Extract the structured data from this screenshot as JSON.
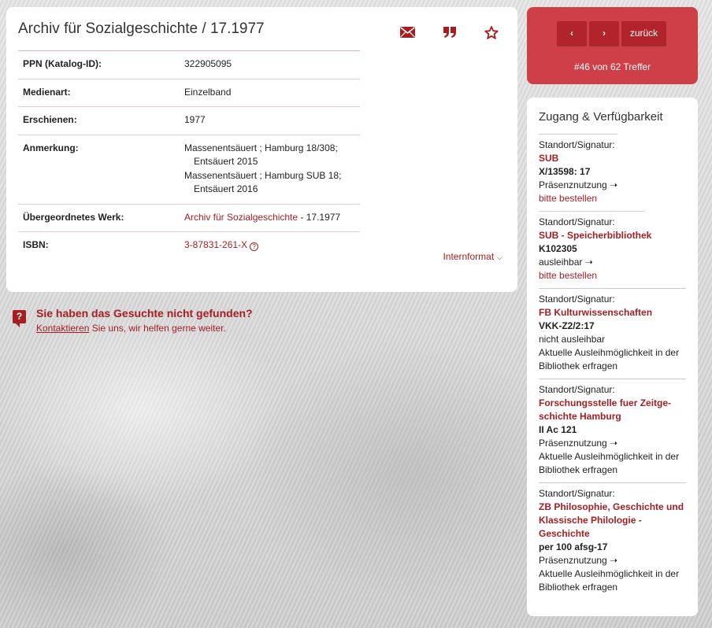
{
  "record": {
    "title": "Archiv für Sozialgeschichte / 17.1977",
    "actions": [
      {
        "icon": "mail-icon"
      },
      {
        "icon": "quote-icon"
      },
      {
        "icon": "star-icon"
      }
    ],
    "fields": [
      {
        "key": "PPN (Katalog-ID):",
        "value": "322905095"
      },
      {
        "key": "Medienart:",
        "value": "Einzelband"
      },
      {
        "key": "Erschienen:",
        "value": "1977"
      },
      {
        "key": "Anmerkung:",
        "lines": [
          "Massenentsäuert ; Hamburg 18/308;",
          "Entsäuert 2015",
          "Massenentsäuert ; Hamburg SUB 18;",
          "Entsäuert 2016"
        ]
      },
      {
        "key": "Übergeordnetes Werk:",
        "link": "Archiv für Sozialgeschichte",
        "suffix": " - 17.1977"
      },
      {
        "key": "ISBN:",
        "link": "3-87831-261-X",
        "help": "?"
      }
    ],
    "internformat": "Internformat"
  },
  "not_found": {
    "icon": "question-bubble-icon",
    "title": "Sie haben das Gesuchte nicht gefunden?",
    "link": "Kontaktieren",
    "text": " Sie uns, wir helfen gerne weiter."
  },
  "navigation": {
    "prev": "‹",
    "next": "›",
    "back": "zurück",
    "hits": "#46 von 62 Treffer"
  },
  "availability": {
    "title": "Zugang & Verfügbarkeit",
    "entries": [
      {
        "label": "Standort/Signatur:",
        "location": "SUB",
        "signature": "X/13598: 17",
        "status": "Präsenznutzung ➝",
        "order": "bitte bestellen"
      },
      {
        "label": "Standort/Signatur:",
        "location": "SUB - Speicherbibliothek",
        "signature": "K102305",
        "status": "ausleihbar ➝",
        "order": "bitte bestellen"
      },
      {
        "label": "Standort/Signatur:",
        "location": "FB Kulturwissenschaften",
        "signature": "VKK-Z2/2:17",
        "status": "nicht ausleihbar",
        "info": "Aktuelle Ausleihmöglichkeit in der Bibliothek erfragen"
      },
      {
        "label": "Standort/Signatur:",
        "location": "Forschungsstelle fuer Zeitge-schichte Hamburg",
        "signature": "II Ac 121",
        "status": "Präsenznutzung ➝",
        "info": "Aktuelle Ausleihmöglichkeit in der Bibliothek erfragen"
      },
      {
        "label": "Standort/Signatur:",
        "location": "ZB Philosophie, Geschichte und Klassische Philologie - Geschichte",
        "signature": "per 100 afsg-17",
        "status": "Präsenznutzung ➝",
        "info": "Aktuelle Ausleihmöglichkeit in der Bibliothek erfragen"
      }
    ]
  },
  "colors": {
    "accent": "#a51e22",
    "nav_bg": "#cf3f48",
    "nav_button": "#b2242c"
  }
}
